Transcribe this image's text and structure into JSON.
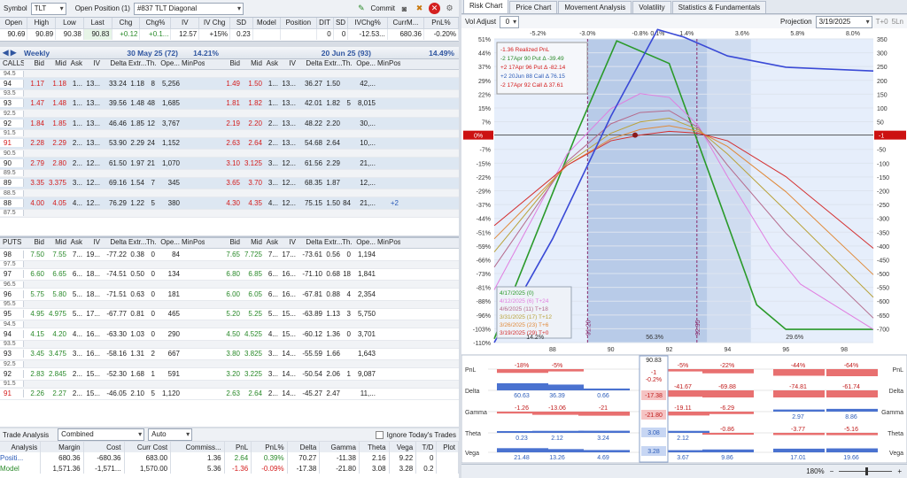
{
  "toolbar": {
    "symbol_label": "Symbol",
    "symbol": "TLT",
    "position_label": "Open Position (1)",
    "position": "#837 TLT Diagonal",
    "commit": "Commit"
  },
  "quote": {
    "headers": [
      "Open",
      "High",
      "Low",
      "Last",
      "Chg",
      "Chg%",
      "IV",
      "IV Chg",
      "SD",
      "Model",
      "Position",
      "DIT",
      "SD",
      "IVChg%",
      "CurrM...",
      "PnL%"
    ],
    "values": [
      "90.69",
      "90.89",
      "90.38",
      "90.83",
      "+0.12",
      "+0.1...",
      "12.57",
      "+15%",
      "0.23",
      "",
      "",
      "0",
      "0",
      "-12.53...",
      "680.36",
      "-0.20%"
    ]
  },
  "weekly": {
    "title": "Weekly",
    "exp": "30 May 25 (72)",
    "iv": "14.21%"
  },
  "monthly": {
    "title": "",
    "exp": "20 Jun 25 (93)",
    "iv": "14.49%"
  },
  "chain_headers": [
    "Bid",
    "Mid",
    "Ask",
    "IV",
    "Delta",
    "Extr...",
    "Th...",
    "Ope...",
    "Min",
    "Pos"
  ],
  "calls_label": "CALLS",
  "puts_label": "PUTS",
  "calls": [
    {
      "s": "94.5",
      "half": true
    },
    {
      "s": "94",
      "l": [
        "1.17",
        "1.18",
        "1...",
        "13...",
        "33.24",
        "1.18",
        "8",
        "5,256",
        "",
        ""
      ],
      "r": [
        "1.49",
        "1.50",
        "1...",
        "13...",
        "36.27",
        "1.50",
        "",
        "42,...",
        "",
        ""
      ]
    },
    {
      "s": "93.5",
      "half": true
    },
    {
      "s": "93",
      "l": [
        "1.47",
        "1.48",
        "1...",
        "13...",
        "39.56",
        "1.48",
        "48",
        "1,685",
        "",
        ""
      ],
      "r": [
        "1.81",
        "1.82",
        "1...",
        "13...",
        "42.01",
        "1.82",
        "5",
        "8,015",
        "",
        ""
      ]
    },
    {
      "s": "92.5",
      "half": true
    },
    {
      "s": "92",
      "l": [
        "1.84",
        "1.85",
        "1...",
        "13...",
        "46.46",
        "1.85",
        "12",
        "3,767",
        "",
        ""
      ],
      "r": [
        "2.19",
        "2.20",
        "2...",
        "13...",
        "48.22",
        "2.20",
        "",
        "30,...",
        "",
        ""
      ]
    },
    {
      "s": "91.5",
      "half": true
    },
    {
      "s": "91",
      "l": [
        "2.28",
        "2.29",
        "2...",
        "13...",
        "53.90",
        "2.29",
        "24",
        "1,152",
        "",
        ""
      ],
      "r": [
        "2.63",
        "2.64",
        "2...",
        "13...",
        "54.68",
        "2.64",
        "",
        "10,...",
        "",
        ""
      ],
      "sr": true
    },
    {
      "s": "90.5",
      "half": true
    },
    {
      "s": "90",
      "l": [
        "2.79",
        "2.80",
        "2...",
        "12...",
        "61.50",
        "1.97",
        "21",
        "1,070",
        "",
        ""
      ],
      "r": [
        "3.10",
        "3.125",
        "3...",
        "12...",
        "61.56",
        "2.29",
        "",
        "21,...",
        "",
        ""
      ]
    },
    {
      "s": "89.5",
      "half": true
    },
    {
      "s": "89",
      "l": [
        "3.35",
        "3.375",
        "3...",
        "12...",
        "69.16",
        "1.54",
        "7",
        "345",
        "",
        ""
      ],
      "r": [
        "3.65",
        "3.70",
        "3...",
        "12...",
        "68.35",
        "1.87",
        "",
        "12,...",
        "",
        ""
      ]
    },
    {
      "s": "88.5",
      "half": true
    },
    {
      "s": "88",
      "l": [
        "4.00",
        "4.05",
        "4...",
        "12...",
        "76.29",
        "1.22",
        "5",
        "380",
        "",
        ""
      ],
      "r": [
        "4.30",
        "4.35",
        "4...",
        "12...",
        "75.15",
        "1.50",
        "84",
        "21,...",
        "",
        "+2"
      ]
    },
    {
      "s": "87.5",
      "half": true
    }
  ],
  "puts": [
    {
      "s": "98",
      "l": [
        "7.50",
        "7.55",
        "7...",
        "19...",
        "-77.22",
        "0.38",
        "0",
        "84",
        "",
        ""
      ],
      "r": [
        "7.65",
        "7.725",
        "7...",
        "17...",
        "-73.61",
        "0.56",
        "0",
        "1,194",
        "",
        ""
      ]
    },
    {
      "s": "97.5",
      "half": true
    },
    {
      "s": "97",
      "l": [
        "6.60",
        "6.65",
        "6...",
        "18...",
        "-74.51",
        "0.50",
        "0",
        "134",
        "",
        ""
      ],
      "r": [
        "6.80",
        "6.85",
        "6...",
        "16...",
        "-71.10",
        "0.68",
        "18",
        "1,841",
        "",
        ""
      ]
    },
    {
      "s": "96.5",
      "half": true
    },
    {
      "s": "96",
      "l": [
        "5.75",
        "5.80",
        "5...",
        "18...",
        "-71.51",
        "0.63",
        "0",
        "181",
        "",
        ""
      ],
      "r": [
        "6.00",
        "6.05",
        "6...",
        "16...",
        "-67.81",
        "0.88",
        "4",
        "2,354",
        "",
        ""
      ]
    },
    {
      "s": "95.5",
      "half": true
    },
    {
      "s": "95",
      "l": [
        "4.95",
        "4.975",
        "5...",
        "17...",
        "-67.77",
        "0.81",
        "0",
        "465",
        "",
        ""
      ],
      "r": [
        "5.20",
        "5.25",
        "5...",
        "15...",
        "-63.89",
        "1.13",
        "3",
        "5,750",
        "",
        ""
      ]
    },
    {
      "s": "94.5",
      "half": true
    },
    {
      "s": "94",
      "l": [
        "4.15",
        "4.20",
        "4...",
        "16...",
        "-63.30",
        "1.03",
        "0",
        "290",
        "",
        ""
      ],
      "r": [
        "4.50",
        "4.525",
        "4...",
        "15...",
        "-60.12",
        "1.36",
        "0",
        "3,701",
        "",
        ""
      ]
    },
    {
      "s": "93.5",
      "half": true
    },
    {
      "s": "93",
      "l": [
        "3.45",
        "3.475",
        "3...",
        "16...",
        "-58.16",
        "1.31",
        "2",
        "667",
        "",
        ""
      ],
      "r": [
        "3.80",
        "3.825",
        "3...",
        "14...",
        "-55.59",
        "1.66",
        "",
        "1,643",
        "",
        ""
      ]
    },
    {
      "s": "92.5",
      "half": true
    },
    {
      "s": "92",
      "l": [
        "2.83",
        "2.845",
        "2...",
        "15...",
        "-52.30",
        "1.68",
        "1",
        "591",
        "",
        ""
      ],
      "r": [
        "3.20",
        "3.225",
        "3...",
        "14...",
        "-50.54",
        "2.06",
        "1",
        "9,087",
        "",
        ""
      ]
    },
    {
      "s": "91.5",
      "half": true
    },
    {
      "s": "91",
      "l": [
        "2.26",
        "2.27",
        "2...",
        "15...",
        "-46.05",
        "2.10",
        "5",
        "1,120",
        "",
        ""
      ],
      "r": [
        "2.63",
        "2.64",
        "2...",
        "14...",
        "-45.27",
        "2.47",
        "",
        "11,...",
        "",
        ""
      ],
      "sr": true
    }
  ],
  "trade": {
    "label": "Trade Analysis",
    "mode": "Combined",
    "auto": "Auto",
    "ignore": "Ignore Today's Trades",
    "headers": [
      "Analysis",
      "Margin",
      "Cost",
      "Curr Cost",
      "Commiss...",
      "PnL",
      "PnL%",
      "Delta",
      "Gamma",
      "Theta",
      "Vega",
      "T/D",
      "Plot"
    ],
    "rows": [
      [
        "Positi...",
        "680.36",
        "-680.36",
        "683.00",
        "1.36",
        "2.64",
        "0.39%",
        "70.27",
        "-11.38",
        "2.16",
        "9.22",
        "0",
        ""
      ],
      [
        "Model",
        "1,571.36",
        "-1,571...",
        "1,570.00",
        "5.36",
        "-1.36",
        "-0.09%",
        "-17.38",
        "-21.80",
        "3.08",
        "3.28",
        "0.2",
        ""
      ]
    ]
  },
  "tabs": [
    "Risk Chart",
    "Price Chart",
    "Movement Analysis",
    "Volatility",
    "Statistics & Fundamentals"
  ],
  "risk": {
    "vol_adjust_label": "Vol Adjust",
    "vol_adjust": "0",
    "projection_label": "Projection",
    "projection": "3/19/2025",
    "t0": "T+0",
    "sln": "5Ln",
    "zoom": "180%"
  },
  "chart_data": {
    "type": "line",
    "x_ticks": [
      88,
      90,
      92,
      94,
      96,
      98
    ],
    "pct_ticks": [
      "-5.2%",
      "-3.0%",
      "-0.8%",
      "0.1%",
      "1.4%",
      "3.6%",
      "5.8%",
      "8.0%"
    ],
    "y_left": [
      "51%",
      "44%",
      "37%",
      "29%",
      "22%",
      "15%",
      "7%",
      "0%",
      "-7%",
      "-15%",
      "-22%",
      "-29%",
      "-37%",
      "-44%",
      "-51%",
      "-59%",
      "-66%",
      "-73%",
      "-81%",
      "-88%",
      "-96%",
      "-103%",
      "-110%"
    ],
    "y_right": [
      "350",
      "300",
      "250",
      "200",
      "150",
      "100",
      "50",
      "0",
      "-50",
      "-100",
      "-150",
      "-200",
      "-250",
      "-300",
      "-350",
      "-400",
      "-450",
      "-500",
      "-550",
      "-600",
      "-650",
      "-700"
    ],
    "zero_left": "0%",
    "zero_right": "-1",
    "legend": [
      {
        "t": "-1.36 Realized PnL",
        "c": "#d41c1c"
      },
      {
        "t": "-2 17Apr 90 Put Δ -39.49",
        "c": "#2a8a2a"
      },
      {
        "t": "+2 17Apr 96 Put Δ -82.14",
        "c": "#d41c1c"
      },
      {
        "t": "+2 20Jun 88 Call Δ 76.15",
        "c": "#2b5bb8"
      },
      {
        "t": "-2 17Apr 92 Call Δ 37.61",
        "c": "#d41c1c"
      }
    ],
    "dates": [
      "4/17/2025 (0)",
      "4/12/2025 (6) T+24",
      "4/6/2025 (11) T+18",
      "3/31/2025 (17) T+12",
      "3/26/2025 (23) T+6",
      "3/19/2025 (29) T+0"
    ],
    "pct_bottom": [
      "14.2%",
      "56.3%",
      "29.6%"
    ],
    "sd_labels": [
      "91.20",
      "92.95"
    ],
    "curves": [
      {
        "name": "4/17",
        "color": "#2a9a2a",
        "pts": [
          [
            86,
            -108
          ],
          [
            88.8,
            0
          ],
          [
            90.2,
            50
          ],
          [
            92,
            38
          ],
          [
            93.6,
            -30
          ],
          [
            95,
            -90
          ],
          [
            96,
            -103
          ],
          [
            99,
            -103
          ]
        ]
      },
      {
        "name": "4/12",
        "color": "#e07ee0",
        "pts": [
          [
            86,
            -82
          ],
          [
            88.5,
            -10
          ],
          [
            90,
            14
          ],
          [
            91,
            22
          ],
          [
            92,
            20
          ],
          [
            93,
            5
          ],
          [
            94,
            -22
          ],
          [
            95.5,
            -60
          ],
          [
            96.5,
            -79
          ],
          [
            99,
            -103
          ]
        ]
      },
      {
        "name": "4/6",
        "color": "#b56a8c",
        "pts": [
          [
            86,
            -70
          ],
          [
            88.5,
            -14
          ],
          [
            90,
            6
          ],
          [
            91,
            12
          ],
          [
            92,
            13
          ],
          [
            93,
            4
          ],
          [
            94,
            -16
          ],
          [
            96,
            -52
          ],
          [
            99,
            -97
          ]
        ]
      },
      {
        "name": "3/31",
        "color": "#b9a23a",
        "pts": [
          [
            86,
            -62
          ],
          [
            88.5,
            -15
          ],
          [
            90,
            1
          ],
          [
            91,
            7
          ],
          [
            92,
            9
          ],
          [
            93,
            3
          ],
          [
            94,
            -10
          ],
          [
            96,
            -40
          ],
          [
            99,
            -86
          ]
        ]
      },
      {
        "name": "3/26",
        "color": "#e08a3a",
        "pts": [
          [
            86,
            -55
          ],
          [
            88.5,
            -16
          ],
          [
            90,
            -2
          ],
          [
            91,
            3
          ],
          [
            92,
            5
          ],
          [
            93,
            2
          ],
          [
            94,
            -6
          ],
          [
            96,
            -30
          ],
          [
            99,
            -74
          ]
        ]
      },
      {
        "name": "3/19",
        "color": "#d43030",
        "pts": [
          [
            86,
            -48
          ],
          [
            88.5,
            -16
          ],
          [
            90,
            -3
          ],
          [
            91,
            0
          ],
          [
            92,
            2
          ],
          [
            93,
            1
          ],
          [
            94,
            -3
          ],
          [
            96,
            -22
          ],
          [
            99,
            -60
          ]
        ]
      },
      {
        "name": "88C",
        "color": "#3a4ad6",
        "pts": [
          [
            86,
            -110
          ],
          [
            88,
            -55
          ],
          [
            90,
            10
          ],
          [
            91.6,
            56
          ],
          [
            92.5,
            52
          ],
          [
            94,
            42
          ],
          [
            96,
            36
          ],
          [
            99,
            34
          ]
        ]
      }
    ]
  },
  "greeks": {
    "labels": [
      "PnL",
      "Delta",
      "Gamma",
      "Theta",
      "Vega"
    ],
    "center": {
      "price": "90.83",
      "pnl": "-1",
      "pnl_pct": "-0.2%",
      "delta": "-17.38",
      "gamma": "-21.80",
      "theta": "3.08",
      "vega": "3.28"
    },
    "pnl": [
      "-18%",
      "-5%",
      "",
      "",
      "-5%",
      "-22%",
      "-44%",
      "-64%"
    ],
    "delta": [
      "60.63",
      "36.39",
      "0.66",
      "",
      "-41.67",
      "-69.88",
      "-74.81",
      "-61.74"
    ],
    "gamma": [
      "-1.26",
      "-13.06",
      "-21",
      "",
      "-19.11",
      "-6.29",
      "2.97",
      "8.86"
    ],
    "theta": [
      "0.23",
      "2.12",
      "3.24",
      "",
      "2.12",
      "-0.86",
      "-3.77",
      "-5.16"
    ],
    "vega": [
      "21.48",
      "13.26",
      "4.69",
      "",
      "3.67",
      "9.86",
      "17.01",
      "19.66"
    ]
  }
}
